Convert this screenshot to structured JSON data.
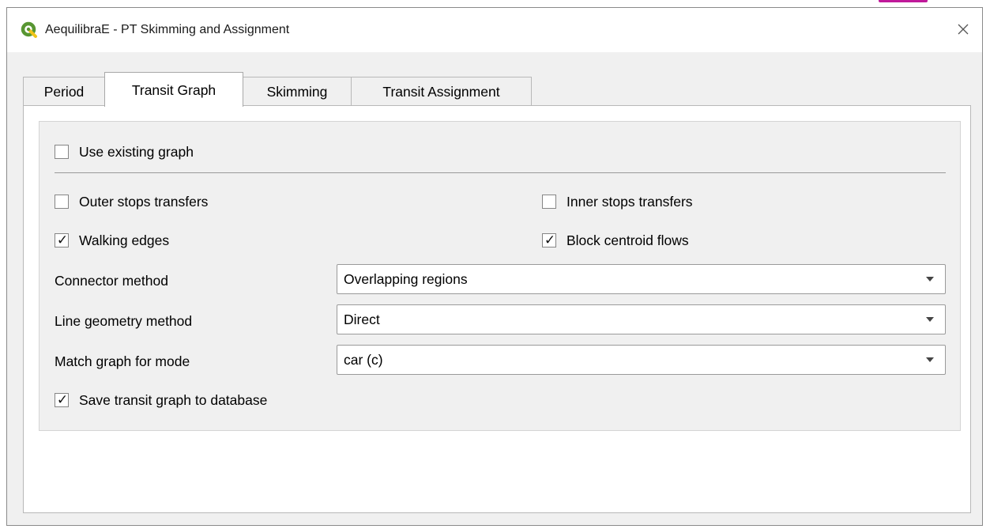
{
  "window": {
    "title": "AequilibraE - PT Skimming and Assignment"
  },
  "tabs": [
    {
      "label": "Period",
      "active": false
    },
    {
      "label": "Transit Graph",
      "active": true
    },
    {
      "label": "Skimming",
      "active": false
    },
    {
      "label": "Transit Assignment",
      "active": false
    }
  ],
  "graph": {
    "use_existing": {
      "label": "Use existing graph",
      "checked": false
    },
    "outer_stops": {
      "label": "Outer stops transfers",
      "checked": false
    },
    "inner_stops": {
      "label": "Inner stops transfers",
      "checked": false
    },
    "walking_edges": {
      "label": "Walking edges",
      "checked": true
    },
    "block_centroid": {
      "label": "Block centroid flows",
      "checked": true
    },
    "connector_method": {
      "label": "Connector method",
      "value": "Overlapping regions"
    },
    "line_geometry": {
      "label": "Line geometry method",
      "value": "Direct"
    },
    "match_graph": {
      "label": "Match graph for mode",
      "value": "car (c)"
    },
    "save_graph": {
      "label": "Save transit graph to database",
      "checked": true
    }
  },
  "colors": {
    "logo_green": "#589632",
    "accent_pink": "#c0199a"
  }
}
